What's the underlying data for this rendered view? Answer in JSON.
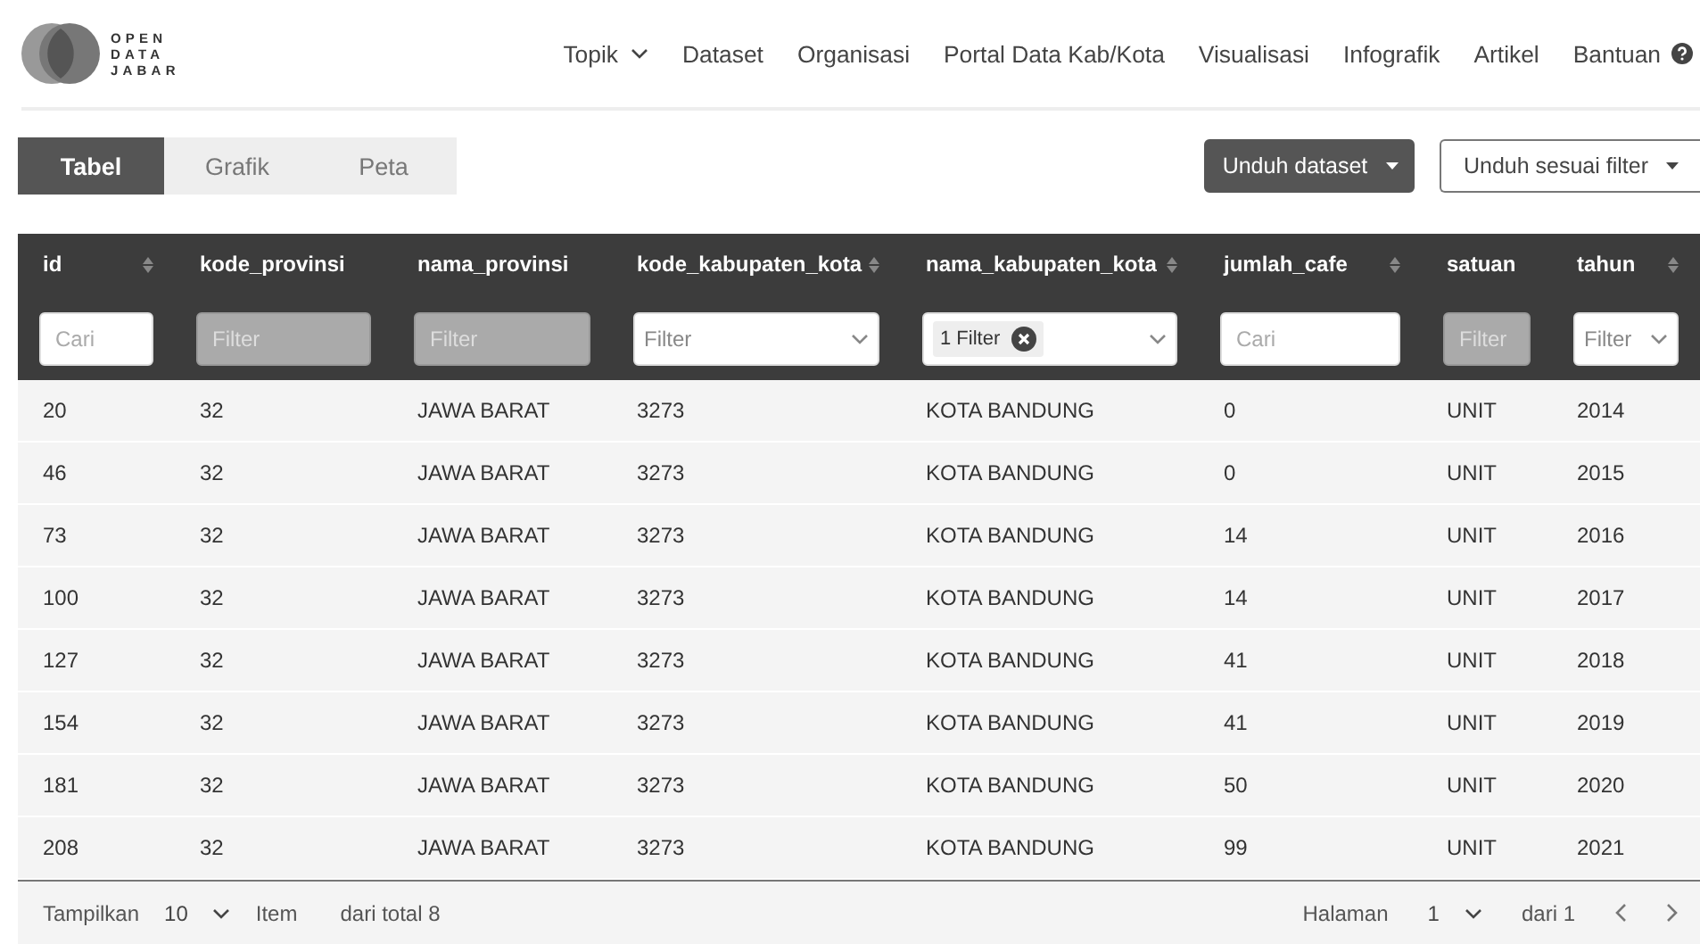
{
  "logo": {
    "lines": [
      "OPEN",
      "DATA",
      "JABAR"
    ]
  },
  "nav": [
    {
      "label": "Topik",
      "dropdown": true,
      "help": false
    },
    {
      "label": "Dataset",
      "dropdown": false,
      "help": false
    },
    {
      "label": "Organisasi",
      "dropdown": false,
      "help": false
    },
    {
      "label": "Portal Data Kab/Kota",
      "dropdown": false,
      "help": false
    },
    {
      "label": "Visualisasi",
      "dropdown": false,
      "help": false
    },
    {
      "label": "Infografik",
      "dropdown": false,
      "help": false
    },
    {
      "label": "Artikel",
      "dropdown": false,
      "help": false
    },
    {
      "label": "Bantuan",
      "dropdown": false,
      "help": true
    }
  ],
  "tabs": [
    {
      "label": "Tabel",
      "selected": true
    },
    {
      "label": "Grafik",
      "selected": false
    },
    {
      "label": "Peta",
      "selected": false
    }
  ],
  "actions": [
    {
      "label": "Unduh dataset",
      "kind": "primary"
    },
    {
      "label": "Unduh sesuai filter",
      "kind": "outline"
    }
  ],
  "table": {
    "columns": [
      {
        "label": "id",
        "sortable": true,
        "filter": {
          "kind": "search",
          "placeholder": "Cari"
        }
      },
      {
        "label": "kode_provinsi",
        "sortable": false,
        "filter": {
          "kind": "disabled",
          "placeholder": "Filter"
        }
      },
      {
        "label": "nama_provinsi",
        "sortable": false,
        "filter": {
          "kind": "disabled",
          "placeholder": "Filter"
        }
      },
      {
        "label": "kode_kabupaten_kota",
        "sortable": true,
        "filter": {
          "kind": "select",
          "placeholder": "Filter"
        }
      },
      {
        "label": "nama_kabupaten_kota",
        "sortable": true,
        "filter": {
          "kind": "chip",
          "value": "1 Filter"
        }
      },
      {
        "label": "jumlah_cafe",
        "sortable": true,
        "filter": {
          "kind": "search",
          "placeholder": "Cari"
        }
      },
      {
        "label": "satuan",
        "sortable": false,
        "filter": {
          "kind": "disabled",
          "placeholder": "Filter"
        }
      },
      {
        "label": "tahun",
        "sortable": true,
        "filter": {
          "kind": "select",
          "placeholder": "Filter"
        }
      }
    ],
    "rows": [
      [
        "20",
        "32",
        "JAWA BARAT",
        "3273",
        "KOTA BANDUNG",
        "0",
        "UNIT",
        "2014"
      ],
      [
        "46",
        "32",
        "JAWA BARAT",
        "3273",
        "KOTA BANDUNG",
        "0",
        "UNIT",
        "2015"
      ],
      [
        "73",
        "32",
        "JAWA BARAT",
        "3273",
        "KOTA BANDUNG",
        "14",
        "UNIT",
        "2016"
      ],
      [
        "100",
        "32",
        "JAWA BARAT",
        "3273",
        "KOTA BANDUNG",
        "14",
        "UNIT",
        "2017"
      ],
      [
        "127",
        "32",
        "JAWA BARAT",
        "3273",
        "KOTA BANDUNG",
        "41",
        "UNIT",
        "2018"
      ],
      [
        "154",
        "32",
        "JAWA BARAT",
        "3273",
        "KOTA BANDUNG",
        "41",
        "UNIT",
        "2019"
      ],
      [
        "181",
        "32",
        "JAWA BARAT",
        "3273",
        "KOTA BANDUNG",
        "50",
        "UNIT",
        "2020"
      ],
      [
        "208",
        "32",
        "JAWA BARAT",
        "3273",
        "KOTA BANDUNG",
        "99",
        "UNIT",
        "2021"
      ]
    ]
  },
  "footer": {
    "show_label": "Tampilkan",
    "page_size": "10",
    "item_label": "Item",
    "total": "dari total 8",
    "page_label": "Halaman",
    "page": "1",
    "page_total": "dari 1"
  }
}
